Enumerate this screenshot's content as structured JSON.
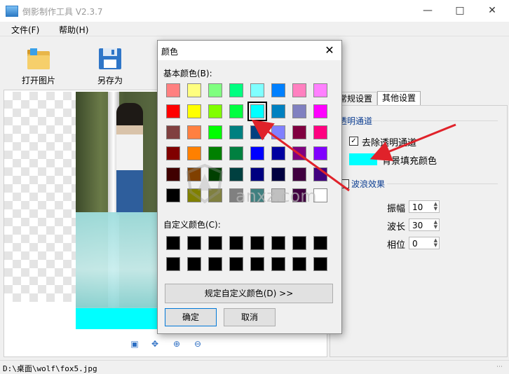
{
  "window": {
    "title": "倒影制作工具 V2.3.7",
    "minimize_icon": "minimize-icon",
    "maximize_icon": "maximize-icon",
    "close_icon": "close-icon"
  },
  "menu": {
    "items": [
      "文件(F)",
      "帮助(H)"
    ]
  },
  "toolbar": {
    "open_label": "打开图片",
    "saveas_label": "另存为"
  },
  "tabs": {
    "normal": "常规设置",
    "other": "其他设置"
  },
  "settings": {
    "alpha_section": "透明通道",
    "remove_alpha_label": "去除透明通道",
    "remove_alpha_checked": true,
    "fill_color_label": "背景填充颜色",
    "fill_color": "#00ffff",
    "wave_section": "波浪效果",
    "wave_checked": false,
    "fields": [
      {
        "label": "振幅",
        "value": "10"
      },
      {
        "label": "波长",
        "value": "30"
      },
      {
        "label": "相位",
        "value": "0"
      }
    ]
  },
  "status": {
    "path": "D:\\桌面\\wolf\\fox5.jpg"
  },
  "watermark": "anxz.com",
  "dialog": {
    "title": "颜色",
    "basic_label": "基本颜色(B):",
    "custom_label": "自定义颜色(C):",
    "define_button": "规定自定义颜色(D) >>",
    "ok": "确定",
    "cancel": "取消",
    "selected": [
      1,
      4
    ],
    "basic_colors": [
      [
        "#ff8080",
        "#ffff80",
        "#80ff80",
        "#00ff80",
        "#80ffff",
        "#0080ff",
        "#ff80c0",
        "#ff80ff"
      ],
      [
        "#ff0000",
        "#ffff00",
        "#80ff00",
        "#00ff40",
        "#00ffff",
        "#0080c0",
        "#8080c0",
        "#ff00ff"
      ],
      [
        "#804040",
        "#ff8040",
        "#00ff00",
        "#008080",
        "#004080",
        "#8080ff",
        "#800040",
        "#ff0080"
      ],
      [
        "#800000",
        "#ff8000",
        "#008000",
        "#008040",
        "#0000ff",
        "#0000a0",
        "#800080",
        "#8000ff"
      ],
      [
        "#400000",
        "#804000",
        "#004000",
        "#004040",
        "#000080",
        "#000040",
        "#400040",
        "#400080"
      ],
      [
        "#000000",
        "#808000",
        "#808040",
        "#808080",
        "#408080",
        "#c0c0c0",
        "#400040",
        "#ffffff"
      ]
    ],
    "custom_colors": [
      [
        "#000000",
        "#000000",
        "#000000",
        "#000000",
        "#000000",
        "#000000",
        "#000000",
        "#000000"
      ],
      [
        "#000000",
        "#000000",
        "#000000",
        "#000000",
        "#000000",
        "#000000",
        "#000000",
        "#000000"
      ]
    ]
  },
  "colors": {
    "annotation_arrow": "#e0222a",
    "accent": "#0078d7"
  }
}
